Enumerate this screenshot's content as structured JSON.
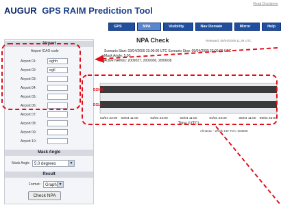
{
  "header": {
    "title": "AUGUR",
    "title_tail": "GPS RAIM Prediction Tool",
    "disclaimer": "Read Disclaimer"
  },
  "nav": {
    "items": [
      "GPS Status",
      "NPA Tool",
      "Visibility Tool",
      "Nav Domain Home",
      "Mirror Site",
      "Help"
    ],
    "active": "NPA Tool"
  },
  "sidebar": {
    "airport_header": "Airport",
    "icao_label": "Airport ICAO code",
    "airports": [
      {
        "label": "Airport 01:",
        "value": "eghh"
      },
      {
        "label": "Airport 02:",
        "value": "egll"
      },
      {
        "label": "Airport 03:",
        "value": ""
      },
      {
        "label": "Airport 04:",
        "value": ""
      },
      {
        "label": "Airport 05:",
        "value": ""
      },
      {
        "label": "Airport 06:",
        "value": ""
      },
      {
        "label": "Airport 07:",
        "value": ""
      },
      {
        "label": "Airport 08:",
        "value": ""
      },
      {
        "label": "Airport 09:",
        "value": ""
      },
      {
        "label": "Airport 10:",
        "value": ""
      }
    ],
    "mask_header": "Mask Angle",
    "mask_label": "Mask Angle",
    "mask_value": "5.0 degrees",
    "result_header": "Result",
    "format_label": "Format:",
    "format_value": "Graphic",
    "check_button": "Check NPA"
  },
  "main": {
    "title": "NPA Check",
    "released": "Released: 05/04/2009 11:39 UTC",
    "scenario": "Scenario Start: 03/04/2009 23:00:00 UTC Scenario Stop: 05/04/2009 23:00:00 UTC",
    "mask": "Mask Angle: 5.00",
    "notams": "Active NANUs: 2009027, 2009036, 2009038",
    "alert_markers": [
      "EGHH",
      "EGLL"
    ],
    "footer": "Almanac - Week 449 TOA: 503808"
  },
  "chart_data": {
    "type": "timeline",
    "categories": [
      "EGHH",
      "EGLL"
    ],
    "x_ticks": [
      "03/04 23:00",
      "03/04 11:00",
      "03/04 23:00",
      "04/04 11:00",
      "04/04 23:00",
      "05/04 11:00",
      "05/04 23:00"
    ],
    "xlabel": "Time (UTC)",
    "series_colors": [
      "#3a3a3a",
      "#3a3a3a"
    ]
  },
  "annotations": {
    "color": "#e0101a"
  }
}
